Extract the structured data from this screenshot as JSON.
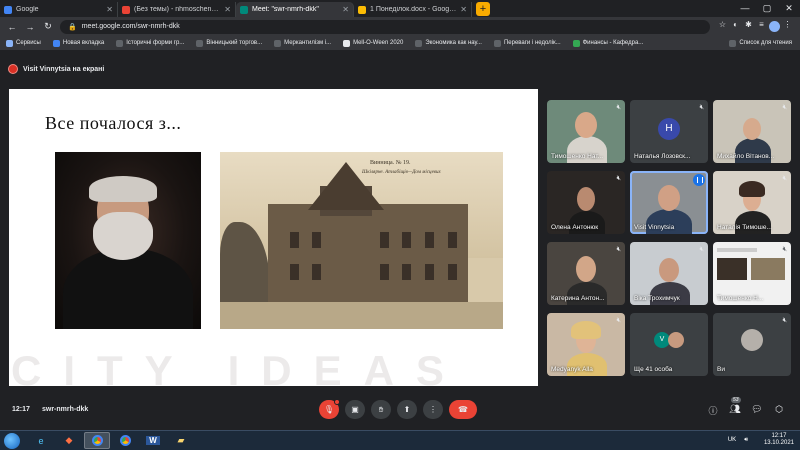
{
  "browser": {
    "tabs": [
      {
        "title": "Google",
        "favicon_color": "#4285f4",
        "active": false
      },
      {
        "title": "(Без темы) - nhmoschenkom@g",
        "favicon_color": "#ea4335",
        "active": false
      },
      {
        "title": "Meet: \"swr-nmrh-dkk\"",
        "favicon_color": "#00897b",
        "active": true
      },
      {
        "title": "1 Понеділок.docx - Google Диск",
        "favicon_color": "#fbbc04",
        "active": false
      }
    ],
    "new_tab_glyph": "+",
    "url": "meet.google.com/swr-nmrh-dkk",
    "bookmarks": [
      "Сервисы",
      "Новая вкладка",
      "Історичні форми гр...",
      "Вінницький торгов...",
      "Меркантилізм і...",
      "Mell-O-Ween 2020",
      "Экономика как нау...",
      "Переваги і недолік...",
      "Финансы - Кафедра..."
    ],
    "bookmarks_right": "Список для чтения"
  },
  "meet": {
    "presenter_banner": "Visit Vinnytsia на екрані",
    "slide": {
      "title": "Все почалося з...",
      "photo_caption": "Винница. № 19.",
      "photo_subcaption": "Шкілярне. Атлабіщів—Дом місцевих",
      "watermark": "CITY IDEAS"
    },
    "participants": [
      {
        "name": "Тимошенко Нат...",
        "muted": true
      },
      {
        "name": "Наталья Лозовск...",
        "muted": true,
        "initial": "H"
      },
      {
        "name": "Михайло Вітанов...",
        "muted": true
      },
      {
        "name": "Олена Антонюк",
        "muted": true
      },
      {
        "name": "Visit Vinnytsia",
        "muted": false,
        "speaking": true
      },
      {
        "name": "Наталія Тимоше...",
        "muted": true
      },
      {
        "name": "Катерина Антон...",
        "muted": true
      },
      {
        "name": "Віка Трохимчук",
        "muted": true
      },
      {
        "name": "Тимошенко Н...",
        "muted": true
      },
      {
        "name": "Medyanyk Alla",
        "muted": true
      },
      {
        "name": "Ще 41 особа",
        "muted": false,
        "initial": "V"
      },
      {
        "name": "Ви",
        "muted": true
      }
    ],
    "clock": "12:17",
    "meeting_code": "swr-nmrh-dkk",
    "people_count": "53"
  },
  "taskbar": {
    "lang": "UK",
    "time": "12:17",
    "date": "13.10.2021"
  },
  "colors": {
    "accent": "#1a73e8",
    "danger": "#ea4335",
    "bg": "#202124"
  }
}
